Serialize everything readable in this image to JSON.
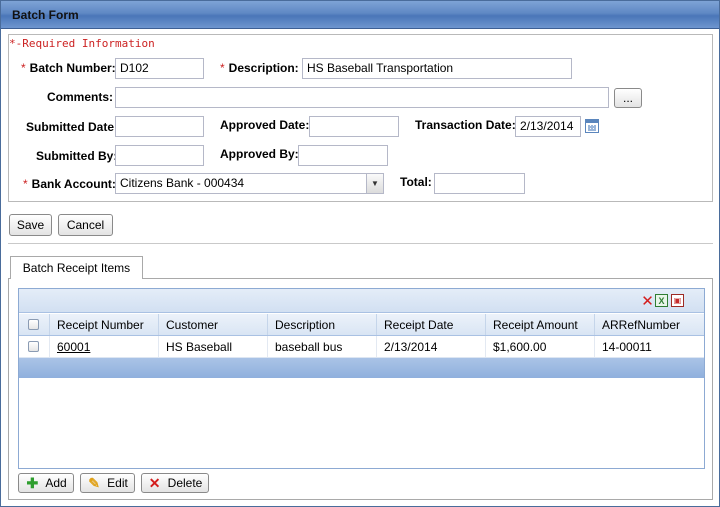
{
  "window": {
    "title": "Batch Form"
  },
  "form": {
    "required_legend": "*-Required Information",
    "batch_number": {
      "label": "Batch Number:",
      "value": "D102"
    },
    "description": {
      "label": "Description:",
      "value": "HS Baseball Transportation"
    },
    "comments": {
      "label": "Comments:",
      "value": "",
      "ellipsis_label": "..."
    },
    "submitted_date": {
      "label": "Submitted Date:",
      "value": ""
    },
    "approved_date": {
      "label": "Approved Date:",
      "value": ""
    },
    "transaction_date": {
      "label": "Transaction Date:",
      "value": "2/13/2014"
    },
    "submitted_by": {
      "label": "Submitted By:",
      "value": ""
    },
    "approved_by": {
      "label": "Approved By:",
      "value": ""
    },
    "bank_account": {
      "label": "Bank Account:",
      "value": "Citizens Bank - 000434"
    },
    "total": {
      "label": "Total:",
      "value": ""
    }
  },
  "actions": {
    "save_label": "Save",
    "cancel_label": "Cancel"
  },
  "tabs": [
    {
      "label": "Batch Receipt Items"
    }
  ],
  "grid": {
    "columns": [
      "Receipt Number",
      "Customer",
      "Description",
      "Receipt Date",
      "Receipt Amount",
      "ARRefNumber"
    ],
    "rows": [
      {
        "receipt_number": "60001",
        "customer": "HS Baseball",
        "description": "baseball bus",
        "receipt_date": "2/13/2014",
        "receipt_amount": "$1,600.00",
        "ar_ref_number": "14-00011"
      }
    ],
    "toolbar_icons": [
      "delete-x-icon",
      "excel-export-icon",
      "pdf-export-icon"
    ]
  },
  "grid_buttons": {
    "add_label": "Add",
    "edit_label": "Edit",
    "delete_label": "Delete"
  },
  "colors": {
    "required": "#cc2222",
    "titlebar": "#5f88c4",
    "grid_header": "#d9e5f4",
    "grid_footer": "#8fb0dd"
  }
}
